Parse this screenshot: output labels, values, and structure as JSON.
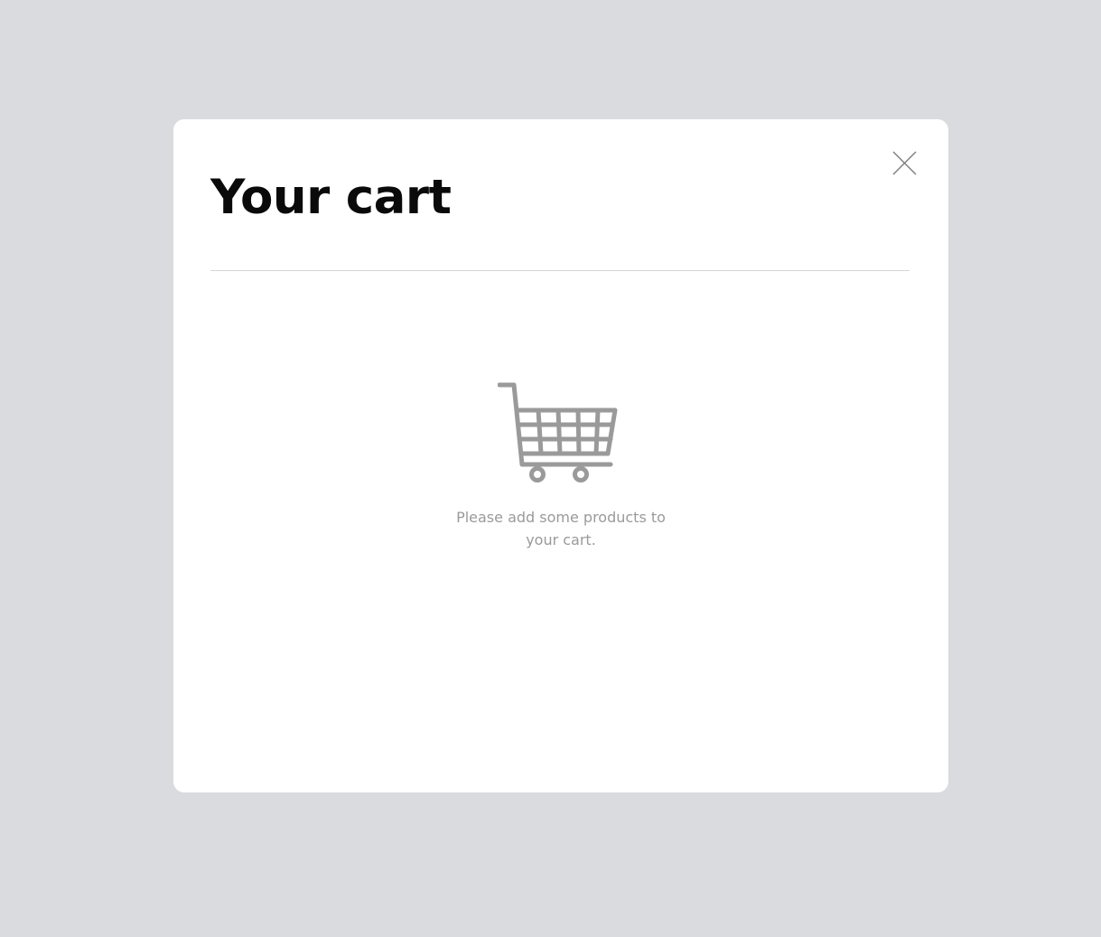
{
  "cart": {
    "title": "Your cart",
    "empty_message": "Please add some products to your cart.",
    "close_icon": "close-icon",
    "cart_icon": "shopping-cart-icon"
  },
  "colors": {
    "backdrop": "#dadbde",
    "modal_background": "#ffffff",
    "title": "#0a0a0a",
    "muted_text": "#9a9a9a",
    "icon": "#9a9a9a"
  }
}
